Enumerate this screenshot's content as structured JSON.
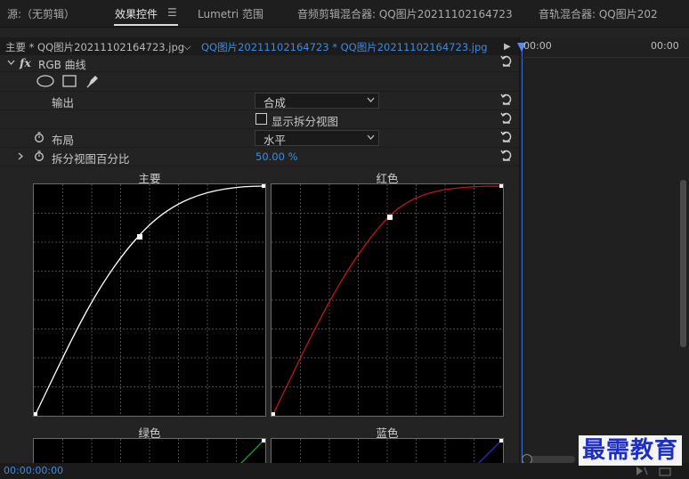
{
  "tabs": {
    "source": "源:（无剪辑）",
    "effect_controls": "效果控件",
    "effect_menu": "☰",
    "lumetri": "Lumetri 范围",
    "audio_clip_mixer": "音频剪辑混合器: QQ图片20211102164723",
    "audio_track_mixer": "音轨混合器: QQ图片202"
  },
  "clipbar": {
    "master": "主要 * QQ图片20211102164723.jpg",
    "chevron": "⌵",
    "clip": "QQ图片20211102164723 * QQ图片20211102164723.jpg",
    "play": "▶"
  },
  "timeline": {
    "time_start": "00:00",
    "time_end": "00:00"
  },
  "effect": {
    "name": "RGB 曲线",
    "fx": "fx",
    "output_label": "输出",
    "output_value": "合成",
    "split_view_label": "显示拆分视图",
    "layout_label": "布局",
    "layout_value": "水平",
    "split_percent_label": "拆分视图百分比",
    "split_percent_value": "50.00 %"
  },
  "curves": {
    "master": "主要",
    "red": "红色",
    "green": "绿色",
    "blue": "蓝色"
  },
  "colors": {
    "accent": "#3b6fd0",
    "red_curve": "#c0161a",
    "green_curve": "#1fa11f",
    "blue_curve": "#2233cc"
  },
  "footer": {
    "timecode": "00:00:00:00"
  },
  "watermark": {
    "text": "最需教育"
  }
}
